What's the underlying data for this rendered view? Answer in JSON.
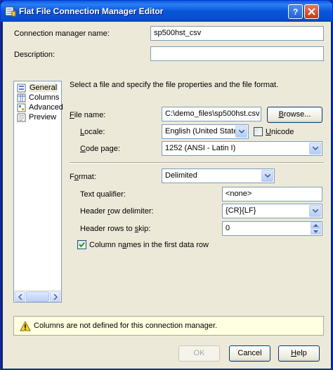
{
  "window": {
    "title": "Flat File Connection Manager Editor"
  },
  "form": {
    "conn_name_label": "Connection manager name:",
    "conn_name_value": "sp500hst_csv",
    "description_label": "Description:",
    "description_value": ""
  },
  "nav": {
    "items": [
      {
        "label": "General",
        "selected": true
      },
      {
        "label": "Columns",
        "selected": false
      },
      {
        "label": "Advanced",
        "selected": false
      },
      {
        "label": "Preview",
        "selected": false
      }
    ]
  },
  "general": {
    "instruction": "Select a file and specify the file properties and the file format.",
    "file_name_label": "File name:",
    "file_name_value": "C:\\demo_files\\sp500hst.csv",
    "browse_label": "Browse...",
    "locale_label": "Locale:",
    "locale_value": "English (United States)",
    "unicode_label": "Unicode",
    "unicode_checked": false,
    "code_page_label": "Code page:",
    "code_page_value": "1252  (ANSI - Latin I)",
    "format_label": "Format:",
    "format_value": "Delimited",
    "text_qualifier_label": "Text qualifier:",
    "text_qualifier_value": "<none>",
    "header_row_delim_label": "Header row delimiter:",
    "header_row_delim_value": "{CR}{LF}",
    "header_rows_skip_label": "Header rows to skip:",
    "header_rows_skip_value": "0",
    "column_names_label": "Column names in the first data row",
    "column_names_checked": true
  },
  "status": {
    "message": "Columns are not defined for this connection manager."
  },
  "buttons": {
    "ok": "OK",
    "cancel": "Cancel",
    "help": "Help"
  },
  "colors": {
    "title_bar": "#0a5ddb",
    "dialog_bg": "#ece9d8",
    "warning_bg": "#ffffe1"
  }
}
